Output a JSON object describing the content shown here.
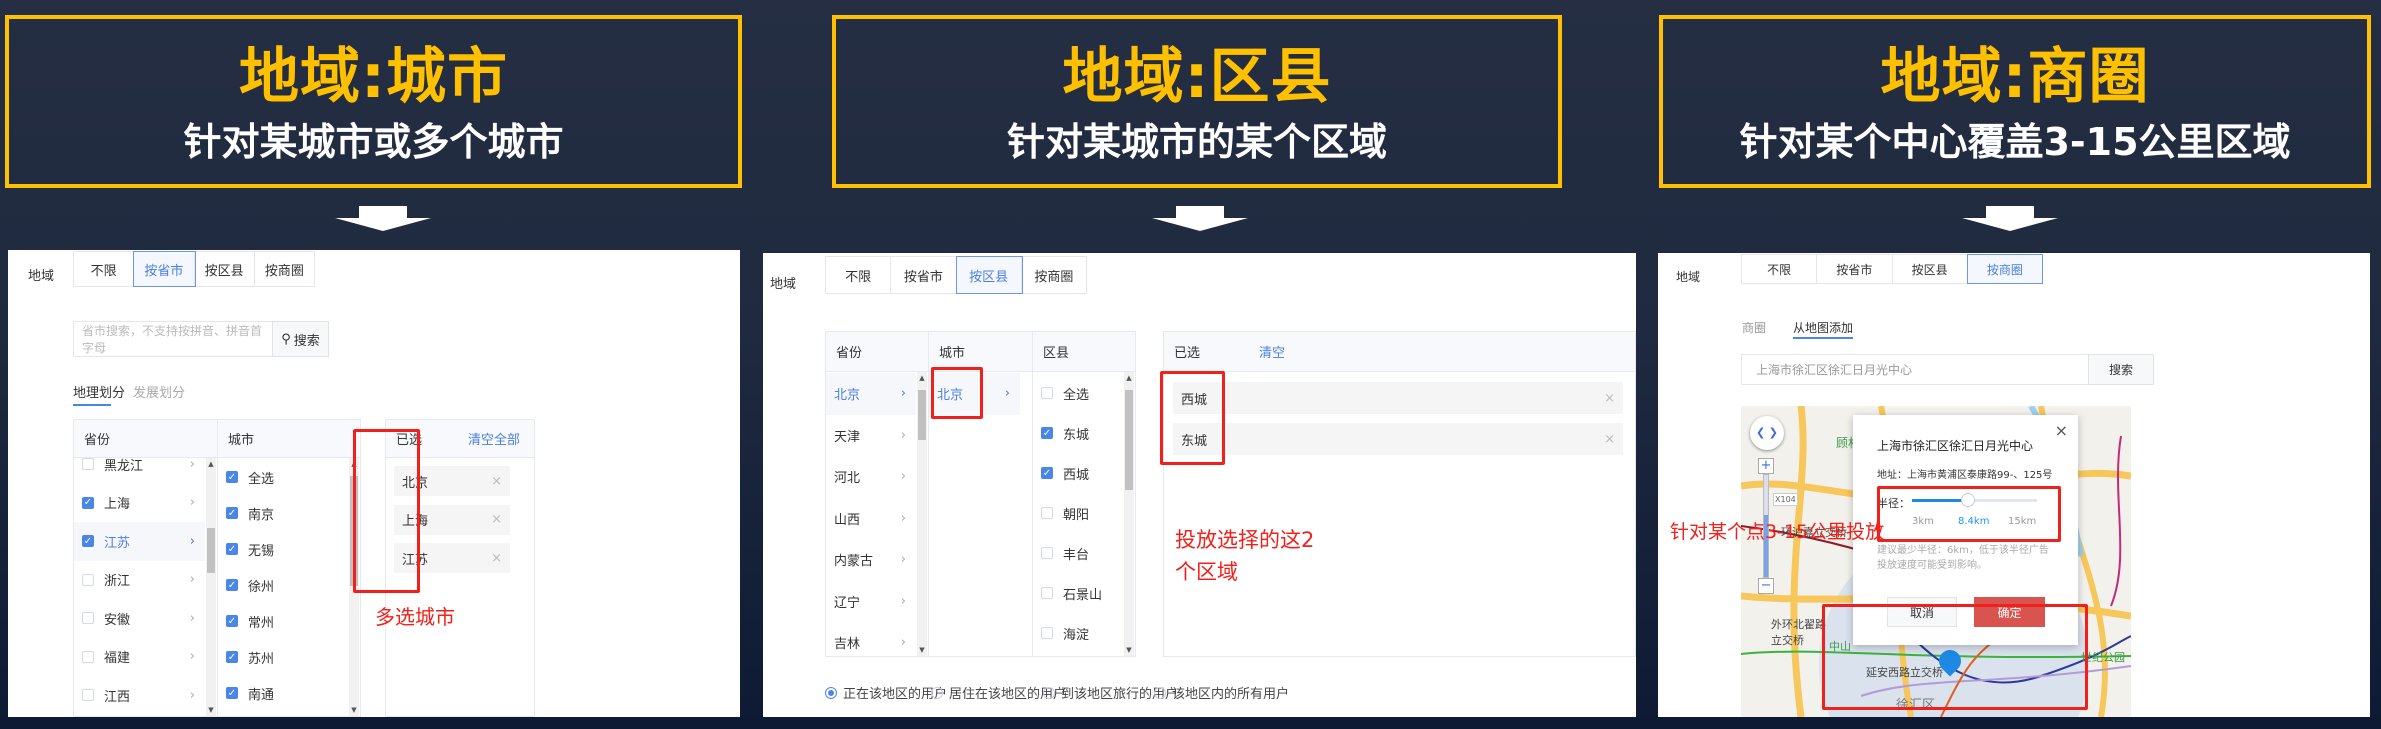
{
  "colors": {
    "accent": "#ffc000",
    "primary": "#4a86e8",
    "annotation": "#f2201b",
    "confirm": "#d9534f"
  },
  "headers": [
    {
      "title": "地域:城市",
      "subtitle": "针对某城市或多个城市"
    },
    {
      "title": "地域:区县",
      "subtitle": "针对某城市的某个区域"
    },
    {
      "title": "地域:商圈",
      "subtitle": "针对某个中心覆盖3-15公里区域"
    }
  ],
  "region_label": "地域",
  "mode_tabs": [
    "不限",
    "按省市",
    "按区县",
    "按商圈"
  ],
  "city_panel": {
    "search_placeholder": "省市搜索，不支持按拼音、拼音首字母",
    "search_button": "搜索",
    "sub_tabs": [
      "地理划分",
      "发展划分"
    ],
    "province_header": "省份",
    "city_header": "城市",
    "provinces": [
      {
        "name": "黑龙江",
        "checked": false
      },
      {
        "name": "上海",
        "checked": true
      },
      {
        "name": "江苏",
        "checked": true,
        "active": true
      },
      {
        "name": "浙江",
        "checked": false
      },
      {
        "name": "安徽",
        "checked": false
      },
      {
        "name": "福建",
        "checked": false
      },
      {
        "name": "江西",
        "checked": false
      }
    ],
    "cities": [
      {
        "name": "全选",
        "checked": true
      },
      {
        "name": "南京",
        "checked": true
      },
      {
        "name": "无锡",
        "checked": true
      },
      {
        "name": "徐州",
        "checked": true
      },
      {
        "name": "常州",
        "checked": true
      },
      {
        "name": "苏州",
        "checked": true
      },
      {
        "name": "南通",
        "checked": true
      }
    ],
    "selected_header": "已选",
    "clear_all": "清空全部",
    "selected": [
      "北京",
      "上海",
      "江苏"
    ],
    "annotation": "多选城市"
  },
  "district_panel": {
    "province_header": "省份",
    "city_header": "城市",
    "district_header": "区县",
    "provinces": [
      {
        "name": "北京",
        "active": true
      },
      {
        "name": "天津"
      },
      {
        "name": "河北"
      },
      {
        "name": "山西"
      },
      {
        "name": "内蒙古"
      },
      {
        "name": "辽宁"
      },
      {
        "name": "吉林"
      }
    ],
    "cities": [
      {
        "name": "北京",
        "active": true
      }
    ],
    "districts": [
      {
        "name": "全选",
        "checked": false
      },
      {
        "name": "东城",
        "checked": true
      },
      {
        "name": "西城",
        "checked": true
      },
      {
        "name": "朝阳",
        "checked": false
      },
      {
        "name": "丰台",
        "checked": false
      },
      {
        "name": "石景山",
        "checked": false
      },
      {
        "name": "海淀",
        "checked": false
      }
    ],
    "selected_header": "已选",
    "clear_all": "清空",
    "selected": [
      "西城",
      "东城"
    ],
    "annotation_line1": "投放选择的这2",
    "annotation_line2": "个区域",
    "user_types": [
      {
        "label": "正在该地区的用户",
        "checked": true
      },
      {
        "label": "居住在该地区的用户",
        "checked": false
      },
      {
        "label": "到该地区旅行的用户",
        "checked": false
      },
      {
        "label": "该地区内的所有用户",
        "checked": false
      }
    ]
  },
  "circle_panel": {
    "sub_tabs": [
      "商圈",
      "从地图添加"
    ],
    "search_value": "上海市徐汇区徐汇日月光中心",
    "search_button": "搜索",
    "popup": {
      "title": "上海市徐汇区徐汇日月光中心",
      "address_label": "地址：",
      "address": "上海市黄浦区泰康路99-、125号",
      "radius_label": "半径：",
      "radius_min": "3km",
      "radius_value": "8.4km",
      "radius_max": "15km",
      "radius_fraction": 0.45,
      "hint": "建议最少半径：6km，低于该半径广告投放速度可能受到影响。",
      "cancel": "取消",
      "confirm": "确定"
    },
    "map_labels": [
      "顾村公园",
      "外环北翟路立交桥",
      "延安西路立交桥",
      "徐汇区",
      "世纪公园",
      "中山",
      "X104",
      "环沪嘉立交桥"
    ],
    "annotation": "针对某个点3-15公里投放"
  }
}
